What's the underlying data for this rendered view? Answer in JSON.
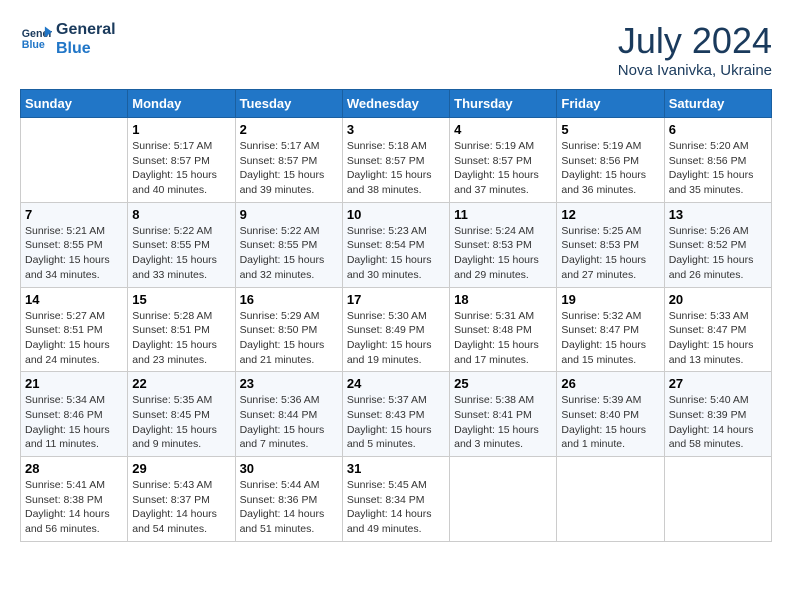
{
  "header": {
    "logo_line1": "General",
    "logo_line2": "Blue",
    "month_year": "July 2024",
    "location": "Nova Ivanivka, Ukraine"
  },
  "days_of_week": [
    "Sunday",
    "Monday",
    "Tuesday",
    "Wednesday",
    "Thursday",
    "Friday",
    "Saturday"
  ],
  "weeks": [
    [
      {
        "day": "",
        "info": ""
      },
      {
        "day": "1",
        "info": "Sunrise: 5:17 AM\nSunset: 8:57 PM\nDaylight: 15 hours\nand 40 minutes."
      },
      {
        "day": "2",
        "info": "Sunrise: 5:17 AM\nSunset: 8:57 PM\nDaylight: 15 hours\nand 39 minutes."
      },
      {
        "day": "3",
        "info": "Sunrise: 5:18 AM\nSunset: 8:57 PM\nDaylight: 15 hours\nand 38 minutes."
      },
      {
        "day": "4",
        "info": "Sunrise: 5:19 AM\nSunset: 8:57 PM\nDaylight: 15 hours\nand 37 minutes."
      },
      {
        "day": "5",
        "info": "Sunrise: 5:19 AM\nSunset: 8:56 PM\nDaylight: 15 hours\nand 36 minutes."
      },
      {
        "day": "6",
        "info": "Sunrise: 5:20 AM\nSunset: 8:56 PM\nDaylight: 15 hours\nand 35 minutes."
      }
    ],
    [
      {
        "day": "7",
        "info": "Sunrise: 5:21 AM\nSunset: 8:55 PM\nDaylight: 15 hours\nand 34 minutes."
      },
      {
        "day": "8",
        "info": "Sunrise: 5:22 AM\nSunset: 8:55 PM\nDaylight: 15 hours\nand 33 minutes."
      },
      {
        "day": "9",
        "info": "Sunrise: 5:22 AM\nSunset: 8:55 PM\nDaylight: 15 hours\nand 32 minutes."
      },
      {
        "day": "10",
        "info": "Sunrise: 5:23 AM\nSunset: 8:54 PM\nDaylight: 15 hours\nand 30 minutes."
      },
      {
        "day": "11",
        "info": "Sunrise: 5:24 AM\nSunset: 8:53 PM\nDaylight: 15 hours\nand 29 minutes."
      },
      {
        "day": "12",
        "info": "Sunrise: 5:25 AM\nSunset: 8:53 PM\nDaylight: 15 hours\nand 27 minutes."
      },
      {
        "day": "13",
        "info": "Sunrise: 5:26 AM\nSunset: 8:52 PM\nDaylight: 15 hours\nand 26 minutes."
      }
    ],
    [
      {
        "day": "14",
        "info": "Sunrise: 5:27 AM\nSunset: 8:51 PM\nDaylight: 15 hours\nand 24 minutes."
      },
      {
        "day": "15",
        "info": "Sunrise: 5:28 AM\nSunset: 8:51 PM\nDaylight: 15 hours\nand 23 minutes."
      },
      {
        "day": "16",
        "info": "Sunrise: 5:29 AM\nSunset: 8:50 PM\nDaylight: 15 hours\nand 21 minutes."
      },
      {
        "day": "17",
        "info": "Sunrise: 5:30 AM\nSunset: 8:49 PM\nDaylight: 15 hours\nand 19 minutes."
      },
      {
        "day": "18",
        "info": "Sunrise: 5:31 AM\nSunset: 8:48 PM\nDaylight: 15 hours\nand 17 minutes."
      },
      {
        "day": "19",
        "info": "Sunrise: 5:32 AM\nSunset: 8:47 PM\nDaylight: 15 hours\nand 15 minutes."
      },
      {
        "day": "20",
        "info": "Sunrise: 5:33 AM\nSunset: 8:47 PM\nDaylight: 15 hours\nand 13 minutes."
      }
    ],
    [
      {
        "day": "21",
        "info": "Sunrise: 5:34 AM\nSunset: 8:46 PM\nDaylight: 15 hours\nand 11 minutes."
      },
      {
        "day": "22",
        "info": "Sunrise: 5:35 AM\nSunset: 8:45 PM\nDaylight: 15 hours\nand 9 minutes."
      },
      {
        "day": "23",
        "info": "Sunrise: 5:36 AM\nSunset: 8:44 PM\nDaylight: 15 hours\nand 7 minutes."
      },
      {
        "day": "24",
        "info": "Sunrise: 5:37 AM\nSunset: 8:43 PM\nDaylight: 15 hours\nand 5 minutes."
      },
      {
        "day": "25",
        "info": "Sunrise: 5:38 AM\nSunset: 8:41 PM\nDaylight: 15 hours\nand 3 minutes."
      },
      {
        "day": "26",
        "info": "Sunrise: 5:39 AM\nSunset: 8:40 PM\nDaylight: 15 hours\nand 1 minute."
      },
      {
        "day": "27",
        "info": "Sunrise: 5:40 AM\nSunset: 8:39 PM\nDaylight: 14 hours\nand 58 minutes."
      }
    ],
    [
      {
        "day": "28",
        "info": "Sunrise: 5:41 AM\nSunset: 8:38 PM\nDaylight: 14 hours\nand 56 minutes."
      },
      {
        "day": "29",
        "info": "Sunrise: 5:43 AM\nSunset: 8:37 PM\nDaylight: 14 hours\nand 54 minutes."
      },
      {
        "day": "30",
        "info": "Sunrise: 5:44 AM\nSunset: 8:36 PM\nDaylight: 14 hours\nand 51 minutes."
      },
      {
        "day": "31",
        "info": "Sunrise: 5:45 AM\nSunset: 8:34 PM\nDaylight: 14 hours\nand 49 minutes."
      },
      {
        "day": "",
        "info": ""
      },
      {
        "day": "",
        "info": ""
      },
      {
        "day": "",
        "info": ""
      }
    ]
  ]
}
